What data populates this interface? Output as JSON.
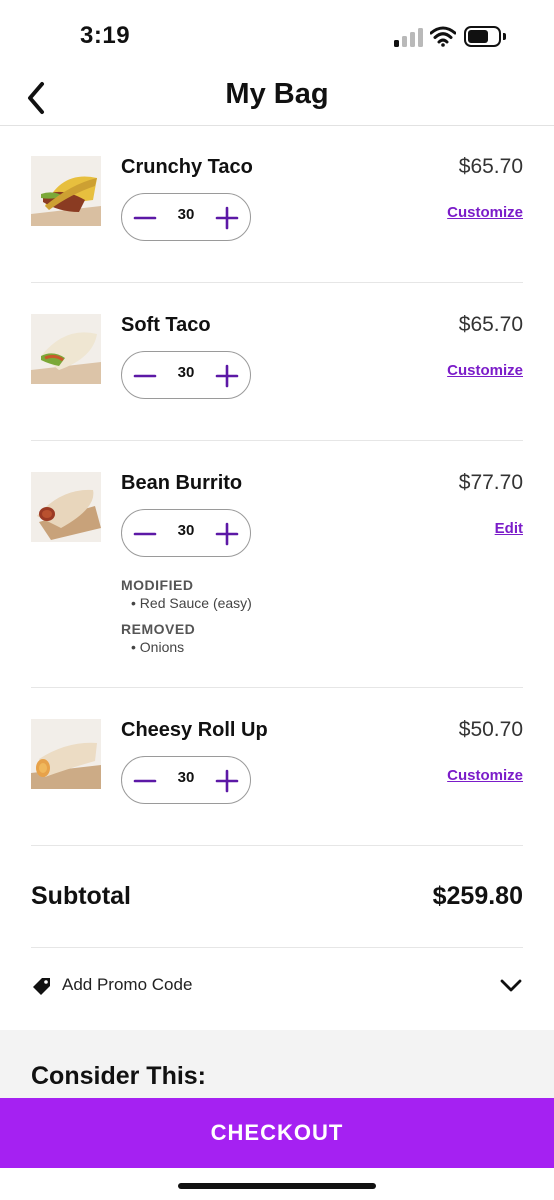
{
  "status_bar": {
    "time": "3:19"
  },
  "header": {
    "title": "My Bag"
  },
  "items": [
    {
      "name": "Crunchy Taco",
      "price": "$65.70",
      "quantity": "30",
      "action": "Customize"
    },
    {
      "name": "Soft Taco",
      "price": "$65.70",
      "quantity": "30",
      "action": "Customize"
    },
    {
      "name": "Bean Burrito",
      "price": "$77.70",
      "quantity": "30",
      "action": "Edit",
      "modified_label": "MODIFIED",
      "modified_value": "• Red Sauce (easy)",
      "removed_label": "REMOVED",
      "removed_value": "• Onions"
    },
    {
      "name": "Cheesy Roll Up",
      "price": "$50.70",
      "quantity": "30",
      "action": "Customize"
    }
  ],
  "summary": {
    "subtotal_label": "Subtotal",
    "subtotal_value": "$259.80"
  },
  "promo": {
    "label": "Add Promo Code"
  },
  "consider": {
    "title": "Consider This:"
  },
  "checkout": {
    "label": "CHECKOUT"
  },
  "colors": {
    "accent": "#a521f2",
    "link": "#7b1cc9"
  }
}
